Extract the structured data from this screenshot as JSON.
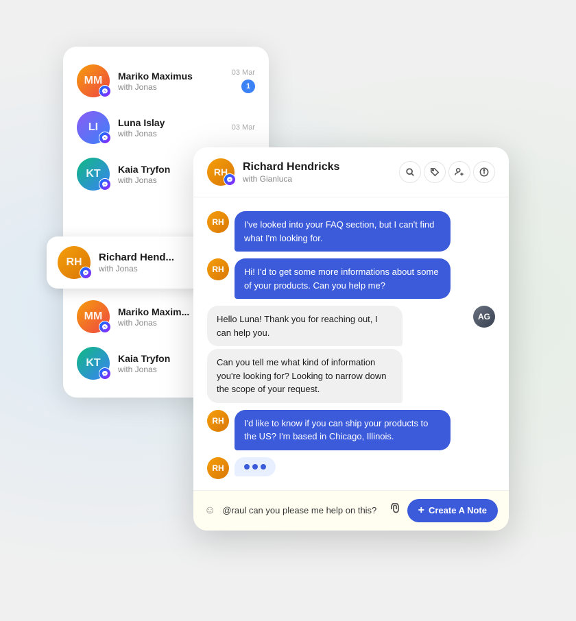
{
  "background": {
    "color": "#f2f2f2"
  },
  "conv_list": {
    "items": [
      {
        "id": "mariko",
        "name": "Mariko Maximus",
        "sub": "with Jonas",
        "date": "03 Mar",
        "unread": 1,
        "initials": "MM",
        "color": "#f59e0b"
      },
      {
        "id": "luna",
        "name": "Luna Islay",
        "sub": "with Jonas",
        "date": "03 Mar",
        "unread": 0,
        "initials": "LI",
        "color": "#8b5cf6"
      },
      {
        "id": "kaia",
        "name": "Kaia Tryfon",
        "sub": "with Jonas",
        "date": "",
        "unread": 0,
        "initials": "KT",
        "color": "#10b981"
      }
    ]
  },
  "highlighted_item": {
    "name": "Richard Hend...",
    "sub": "with Jonas",
    "initials": "RH"
  },
  "conv_list2": {
    "items": [
      {
        "id": "mariko2",
        "name": "Mariko Maxim...",
        "sub": "with Jonas",
        "initials": "MM"
      },
      {
        "id": "kaia2",
        "name": "Kaia Tryfon",
        "sub": "with Jonas",
        "initials": "KT"
      }
    ]
  },
  "chat": {
    "header": {
      "name": "Richard Hendricks",
      "sub": "with Gianluca",
      "initials": "RH"
    },
    "messages": [
      {
        "id": "m1",
        "type": "customer",
        "text": "I've looked into your FAQ section, but I can't find what I'm looking for.",
        "initials": "RH"
      },
      {
        "id": "m2",
        "type": "customer",
        "text": "Hi! I'd to get some more informations about some of your products. Can you help me?",
        "initials": "RH"
      },
      {
        "id": "m3",
        "type": "agent",
        "text": "Hello Luna! Thank you for reaching out, I can help you.",
        "initials": "AG"
      },
      {
        "id": "m4",
        "type": "agent",
        "text": "Can you tell me what kind of information you're looking for? Looking to narrow down the scope of your request.",
        "initials": "AG"
      },
      {
        "id": "m5",
        "type": "customer",
        "text": "I'd like to know if you can ship your products to the US? I'm based in Chicago, Illinois.",
        "initials": "RH"
      },
      {
        "id": "m6",
        "type": "typing",
        "initials": "RH"
      }
    ],
    "input": {
      "value": "@raul can you please me help on this?",
      "placeholder": "@raul can you please me help on this?"
    },
    "create_note_btn": "+ Create A Note",
    "create_note_label": "Create A Note"
  },
  "icons": {
    "search": "search-icon",
    "tag": "tag-icon",
    "add_user": "add-user-icon",
    "info": "info-icon",
    "messenger": "messenger-icon",
    "emoji": "emoji-icon",
    "attachment": "attachment-icon",
    "plus": "plus-icon"
  }
}
